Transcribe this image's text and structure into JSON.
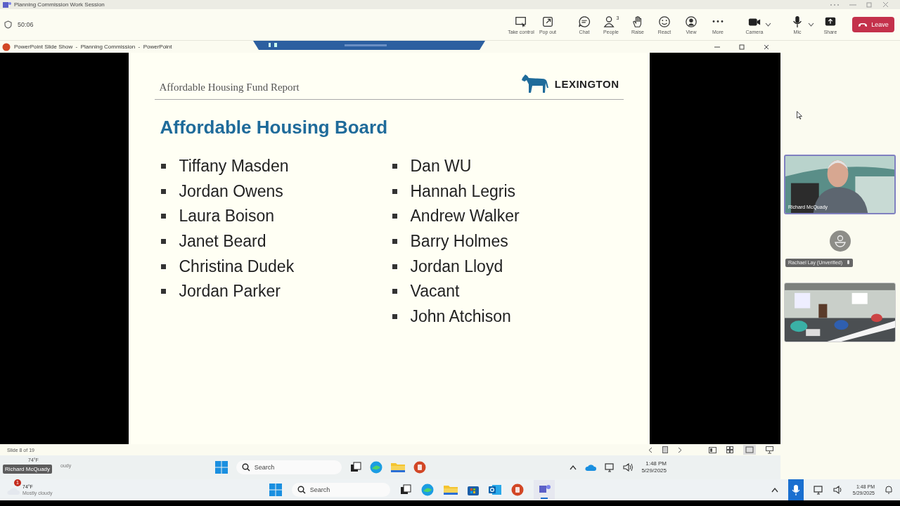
{
  "window": {
    "title": "Planning Commission Work Session"
  },
  "meeting_toolbar": {
    "timer": "50:06",
    "buttons": [
      {
        "label": "Take control",
        "kind": "take-control"
      },
      {
        "label": "Pop out",
        "kind": "pop-out"
      },
      {
        "label": "Chat",
        "kind": "chat"
      },
      {
        "label": "People",
        "kind": "people",
        "count": "3"
      },
      {
        "label": "Raise",
        "kind": "raise"
      },
      {
        "label": "React",
        "kind": "react"
      },
      {
        "label": "View",
        "kind": "view"
      },
      {
        "label": "More",
        "kind": "more"
      },
      {
        "label": "Camera",
        "kind": "camera"
      },
      {
        "label": "Mic",
        "kind": "mic"
      },
      {
        "label": "Share",
        "kind": "share"
      }
    ],
    "leave": "Leave"
  },
  "shared_screen": {
    "window_title": "PowerPoint Slide Show  -  Planning Commission  -  PowerPoint",
    "slide": {
      "header": "Affordable Housing Fund Report",
      "logo": "LEXINGTON",
      "title": "Affordable Housing Board",
      "columns": [
        [
          "Tiffany Masden",
          "Jordan Owens",
          "Laura Boison",
          "Janet Beard",
          "Christina Dudek",
          "Jordan Parker"
        ],
        [
          "Dan WU",
          "Hannah Legris",
          "Andrew Walker",
          "Barry Holmes",
          "Jordan Lloyd",
          "Vacant",
          "John Atchison"
        ]
      ]
    },
    "status": "Slide 8 of 19",
    "inner_taskbar": {
      "weather_temp": "74°F",
      "weather_desc": "oudy",
      "tooltip": "Richard McQuady",
      "search_placeholder": "Search",
      "time": "1:48 PM",
      "date": "5/29/2025"
    }
  },
  "participants": [
    {
      "kind": "video",
      "name": "Richard McQuady"
    },
    {
      "kind": "avatar",
      "name": "Rachael Lay (Unverified)"
    },
    {
      "kind": "room"
    }
  ],
  "taskbar": {
    "weather_badge": "1",
    "weather_temp": "74°F",
    "weather_desc": "Mostly cloudy",
    "search_placeholder": "Search",
    "time": "1:48 PM",
    "date": "5/29/2025"
  }
}
